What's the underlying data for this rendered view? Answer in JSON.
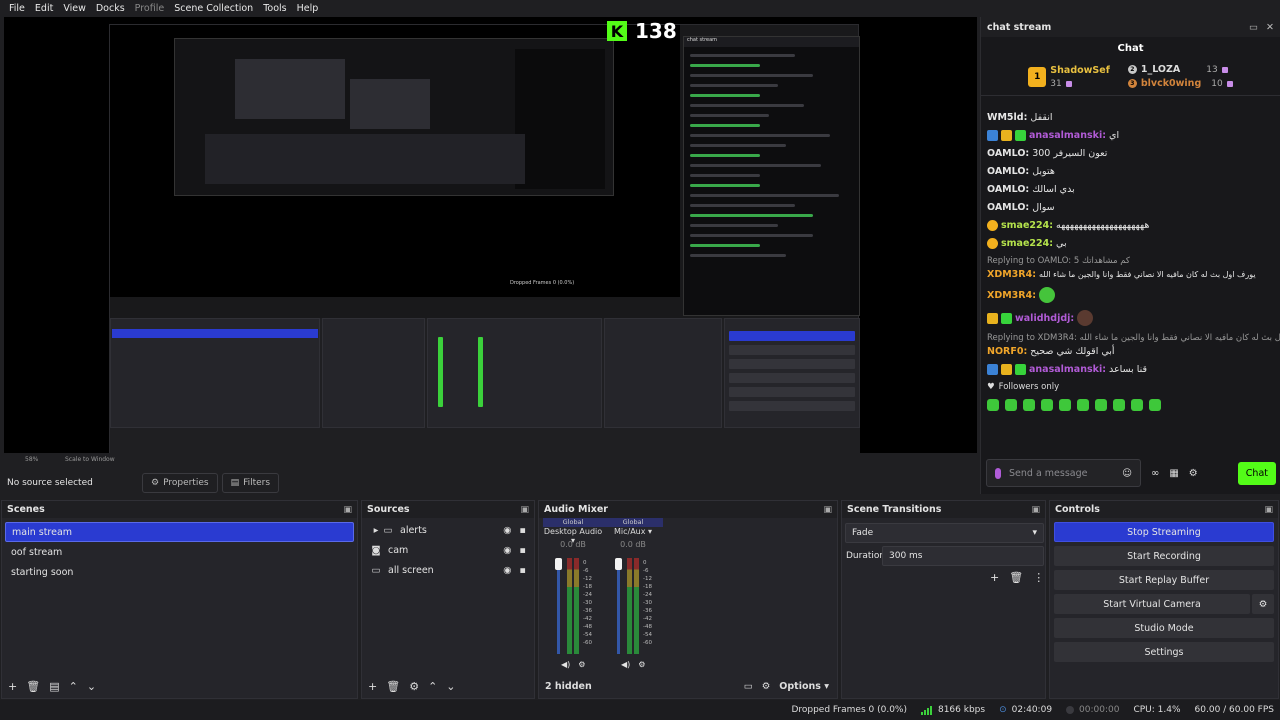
{
  "menu": [
    "File",
    "Edit",
    "View",
    "Docks",
    "Profile",
    "Scene Collection",
    "Tools",
    "Help"
  ],
  "kick": {
    "logo": "K",
    "count": "138"
  },
  "chat_dock": {
    "title": "chat stream",
    "heading": "Chat",
    "leaderboard": {
      "first": {
        "name": "ShadowSef",
        "count": "31"
      },
      "second": {
        "name": "1_LOZA",
        "count": "13"
      },
      "third": {
        "name": "blvck0wing",
        "count": "10"
      }
    },
    "messages": [
      {
        "user": "WM5ld:",
        "text": "انقفل",
        "color": "#e8e8e8"
      },
      {
        "user": "anasalmanski:",
        "text": "اي",
        "color": "#b15bd6",
        "badges": [
          "blue",
          "gold",
          "green"
        ]
      },
      {
        "user": "OAMLO:",
        "text": "300 تعون السيرفر",
        "color": "#e8e8e8"
      },
      {
        "user": "OAMLO:",
        "text": "هتوبل",
        "color": "#e8e8e8"
      },
      {
        "user": "OAMLO:",
        "text": "بدي اسالك",
        "color": "#e8e8e8"
      },
      {
        "user": "OAMLO:",
        "text": "سوال",
        "color": "#e8e8e8"
      },
      {
        "user": "smae224:",
        "text": "ههههههههههههههههههههه",
        "color": "#b5e34c",
        "badges": [
          "coin"
        ]
      },
      {
        "user": "smae224:",
        "text": "بي",
        "color": "#b5e34c",
        "badges": [
          "coin"
        ]
      }
    ],
    "reply1": "Replying to OAMLO: 5 كم مشاهداتك",
    "msg_xdm1": {
      "user": "XDM3R4:",
      "text": "يورف اول بث له كان مافيه الا نصاني فقط وانا والجين ما شاء الله"
    },
    "msg_xdm2": {
      "user": "XDM3R4:"
    },
    "msg_walid": {
      "user": "walidhdjdj:"
    },
    "reply2": "Replying to XDM3R4: يورف اول بث له كان مافيه الا نصاني فقط وانا والجين ما شاء الله",
    "msg_norf": {
      "user": "NORF0:",
      "text": "أبي اقولك شي صحيح"
    },
    "msg_anas2": {
      "user": "anasalmanski:",
      "text": "قنا بساعد"
    },
    "followers_only": "Followers only",
    "input_placeholder": "Send a message",
    "send_label": "Chat"
  },
  "source_bar": {
    "no_source": "No source selected",
    "properties": "Properties",
    "filters": "Filters"
  },
  "scene_bar": {
    "zoom": "58%",
    "scale": "Scale to Window"
  },
  "scenes": {
    "title": "Scenes",
    "items": [
      "main stream",
      "oof stream",
      "starting soon"
    ]
  },
  "sources": {
    "title": "Sources",
    "items": [
      {
        "name": "alerts",
        "icon": "folder-icon"
      },
      {
        "name": "cam",
        "icon": "camera-icon"
      },
      {
        "name": "all screen",
        "icon": "monitor-icon"
      }
    ]
  },
  "mixer": {
    "title": "Audio Mixer",
    "channels": [
      {
        "tag": "Global",
        "device": "Desktop Audio",
        "db": "0.0 dB",
        "level": 1.0
      },
      {
        "tag": "Global",
        "device": "Mic/Aux",
        "db": "0.0 dB",
        "level": 1.0
      }
    ],
    "scale": [
      "0",
      "-6",
      "-12",
      "-18",
      "-24",
      "-30",
      "-36",
      "-42",
      "-48",
      "-54",
      "-60"
    ],
    "hidden": "2 hidden",
    "options": "Options"
  },
  "transitions": {
    "title": "Scene Transitions",
    "type": "Fade",
    "duration_label": "Duration",
    "duration": "300 ms"
  },
  "controls": {
    "title": "Controls",
    "buttons": [
      "Stop Streaming",
      "Start Recording",
      "Start Replay Buffer",
      "Start Virtual Camera",
      "Studio Mode",
      "Settings"
    ]
  },
  "status": {
    "dropped": "Dropped Frames 0 (0.0%)",
    "bitrate": "8166 kbps",
    "stream_time": "02:40:09",
    "rec_time": "00:00:00",
    "cpu": "CPU: 1.4%",
    "fps": "60.00 / 60.00 FPS"
  },
  "colors": {
    "accent": "#2a3bd1",
    "kick_green": "#53fc18"
  }
}
